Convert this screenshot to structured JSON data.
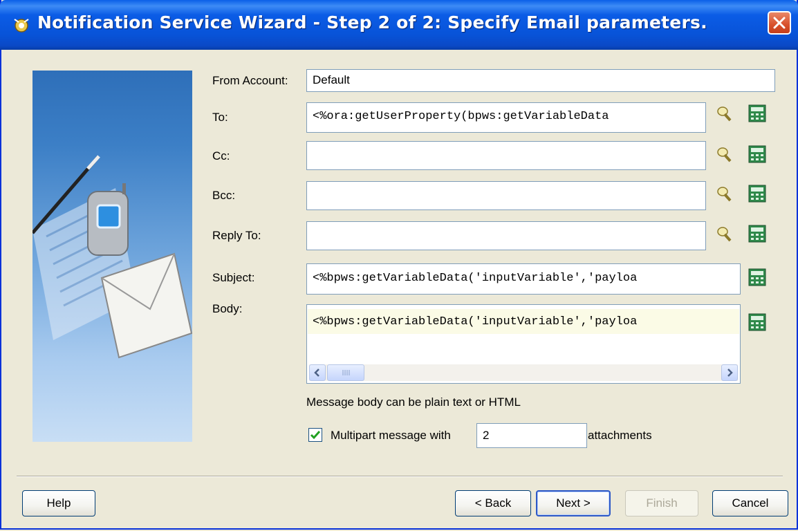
{
  "window": {
    "title": "Notification Service Wizard - Step 2 of 2: Specify Email parameters."
  },
  "form": {
    "from_account": {
      "label": "From Account:",
      "value": "Default"
    },
    "to": {
      "label": "To:",
      "value": "<%ora:getUserProperty(bpws:getVariableData"
    },
    "cc": {
      "label": "Cc:",
      "value": ""
    },
    "bcc": {
      "label": "Bcc:",
      "value": ""
    },
    "reply_to": {
      "label": "Reply To:",
      "value": ""
    },
    "subject": {
      "label": "Subject:",
      "value": "<%bpws:getVariableData('inputVariable','payloa"
    },
    "body": {
      "label": "Body:",
      "value": "<%bpws:getVariableData('inputVariable','payloa",
      "hint": "Message body can be plain text or HTML"
    },
    "multipart": {
      "checked": true,
      "label": "Multipart message with",
      "count": "2",
      "suffix": "attachments"
    }
  },
  "buttons": {
    "help": "Help",
    "back": "< Back",
    "next": "Next >",
    "finish": "Finish",
    "cancel": "Cancel"
  },
  "colors": {
    "titlebar": "#0853d8",
    "dialog_bg": "#ece9d8",
    "body_line_highlight": "#fbfbe6"
  },
  "icons": {
    "user_lookup": "flashlight-icon",
    "expression_builder": "expression-builder-icon",
    "close": "close-icon"
  }
}
